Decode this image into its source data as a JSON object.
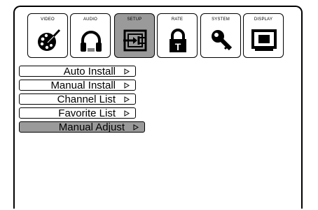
{
  "tabs": [
    {
      "label": "VIDEO",
      "icon": "palette-icon",
      "active": false
    },
    {
      "label": "AUDIO",
      "icon": "headphones-icon",
      "active": false
    },
    {
      "label": "SETUP",
      "icon": "input-icon",
      "active": true
    },
    {
      "label": "RATE",
      "icon": "lock-icon",
      "active": false
    },
    {
      "label": "SYSTEM",
      "icon": "key-icon",
      "active": false
    },
    {
      "label": "DISPLAY",
      "icon": "monitor-icon",
      "active": false
    }
  ],
  "rate_lock_letter": "T",
  "menu": {
    "items": [
      {
        "label": "Auto Install",
        "selected": false
      },
      {
        "label": "Manual Install",
        "selected": false
      },
      {
        "label": "Channel List",
        "selected": false
      },
      {
        "label": "Favorite List",
        "selected": false
      },
      {
        "label": "Manual Adjust",
        "selected": true
      }
    ]
  },
  "colors": {
    "selected": "#9a9a9a",
    "border": "#000000",
    "background": "#ffffff"
  }
}
